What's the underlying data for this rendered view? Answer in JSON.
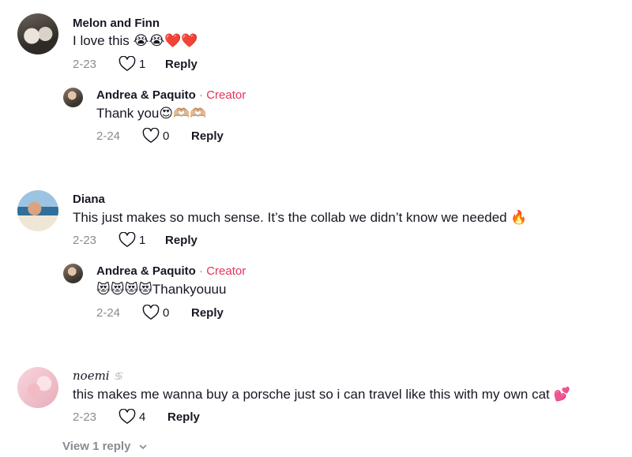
{
  "comments": [
    {
      "name": "Melon and Finn",
      "text": "I love this 😭😭❤️❤️",
      "date": "2-23",
      "likes": "1",
      "reply_label": "Reply",
      "reply": {
        "name": "Andrea & Paquito",
        "separator": "·",
        "badge": "Creator",
        "text": "Thank you😍🫶🏼🫶🏼",
        "date": "2-24",
        "likes": "0",
        "reply_label": "Reply"
      }
    },
    {
      "name": "Diana",
      "text": "This just makes so much sense. It’s the collab we didn’t know we needed 🔥",
      "date": "2-23",
      "likes": "1",
      "reply_label": "Reply",
      "reply": {
        "name": "Andrea & Paquito",
        "separator": "·",
        "badge": "Creator",
        "text": "😻😻😻😻Thankyouuu",
        "date": "2-24",
        "likes": "0",
        "reply_label": "Reply"
      }
    },
    {
      "name": "noemi",
      "name_symbol": "♋︎",
      "text": "this makes me wanna buy a porsche just so i can travel like this with my own cat 💕",
      "date": "2-23",
      "likes": "4",
      "reply_label": "Reply",
      "view_replies": "View 1 reply"
    }
  ],
  "icons": {
    "like": "heart-outline-icon",
    "expand": "chevron-down-icon"
  },
  "colors": {
    "creator": "#e1345a",
    "muted": "#8a8b91",
    "text": "#161823"
  }
}
